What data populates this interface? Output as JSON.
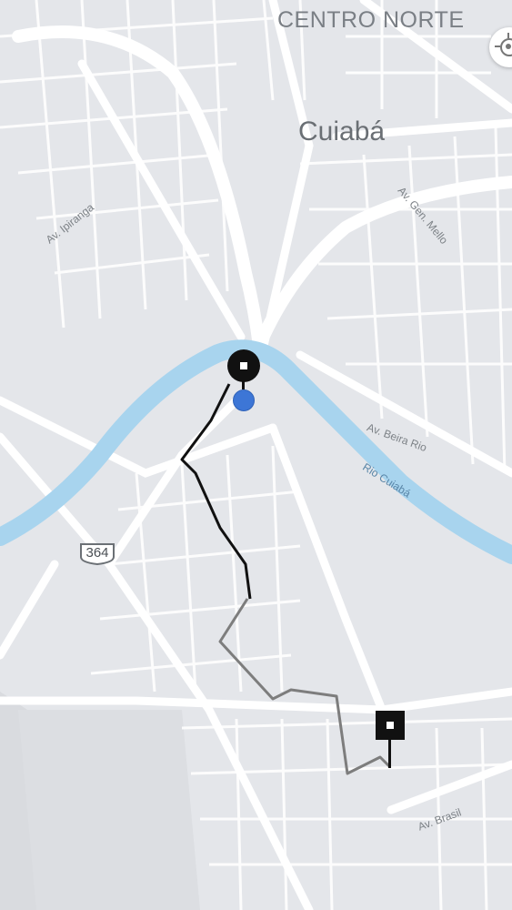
{
  "map": {
    "district_label": "CENTRO NORTE",
    "city_label": "Cuiabá",
    "streets": {
      "ipiranga": "Av. Ipiranga",
      "gen_mello": "Av. Gen. Mello",
      "beira_rio": "Av. Beira Rio",
      "rio_cuiaba": "Rio Cuiabá",
      "brasil": "Av. Brasil"
    },
    "highway_shield": "364"
  },
  "colors": {
    "land": "#e4e6ea",
    "road": "#ffffff",
    "water": "#a8d4ee",
    "route_completed": "#111111",
    "route_remaining": "#7d7d7d",
    "user_location": "#3d76d6",
    "marker": "#111111"
  },
  "markers": {
    "pickup_icon": "pickup-pin-icon",
    "dropoff_icon": "dropoff-square-icon",
    "current_location_icon": "current-location-dot-icon",
    "recenter_icon": "gps-target-icon"
  }
}
